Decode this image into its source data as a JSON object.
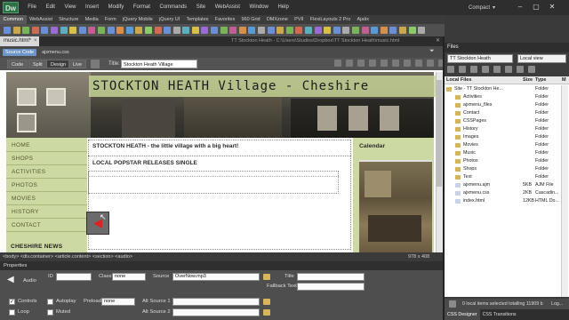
{
  "app": {
    "logo": "Dw",
    "menu": [
      "File",
      "Edit",
      "View",
      "Insert",
      "Modify",
      "Format",
      "Commands",
      "Site",
      "WebAssist",
      "Window",
      "Help"
    ],
    "workspace": "Compact",
    "window_controls": [
      "–",
      "▢",
      "✕"
    ]
  },
  "insert_bar": {
    "tabs": [
      "Common",
      "WebAssist",
      "Structure",
      "Media",
      "Form",
      "jQuery Mobile",
      "jQuery UI",
      "Templates",
      "Favorites",
      "960 Grid",
      "DMXzone",
      "PVII",
      "FlexiLayouts 2 Pro",
      "Ajatix"
    ],
    "active_tab": "Common",
    "icon_colors": [
      "#6b8fd6",
      "#c9a94a",
      "#7bb35a",
      "#d06a50",
      "#6b8fd6",
      "#9a6ad6",
      "#5ab0c0",
      "#d6c04a",
      "#6b8fd6",
      "#c06090",
      "#7bb35a",
      "#6b8fd6",
      "#d6904a",
      "#5a9ad6",
      "#c9a94a",
      "#8acb6a",
      "#d06a50",
      "#6b8fd6",
      "#aaaaaa",
      "#5ab0c0",
      "#d6c04a",
      "#9a6ad6",
      "#6b8fd6",
      "#7bb35a",
      "#c06090",
      "#d6904a",
      "#5a9ad6",
      "#aaaaaa",
      "#6b8fd6",
      "#c9a94a",
      "#7bb35a",
      "#d06a50",
      "#5ab0c0",
      "#9a6ad6",
      "#d6c04a",
      "#6b8fd6",
      "#aaaaaa",
      "#7bb35a",
      "#c06090",
      "#5a9ad6",
      "#d6904a",
      "#6b8fd6",
      "#c9a94a",
      "#8acb6a",
      "#aaaaaa"
    ]
  },
  "document": {
    "tab_label": "music.html*",
    "tab_close": "×",
    "path": "TT Stockton Heath - C:\\Users\\Studios\\Dropbox\\TT Stockton Heath\\music.html",
    "path_close": "✕",
    "related_files": [
      "Source Code",
      "ajxmenu.css"
    ],
    "view_buttons": [
      "Code",
      "Split",
      "Design",
      "Live"
    ],
    "title_label": "Title:",
    "title_value": "Stockton Heath Village"
  },
  "page": {
    "banner_title": "STOCKTON HEATH Village - Cheshire",
    "nav": [
      "HOME",
      "SHOPS",
      "ACTIVITIES",
      "PHOTOS",
      "MOVIES",
      "HISTORY",
      "CONTACT"
    ],
    "news_heading": "CHESHIRE NEWS",
    "headline": "STOCKTON HEATH - the little village with a big heart!",
    "section_heading": "LOCAL POPSTAR RELEASES SINGLE",
    "calendar_heading": "Calendar"
  },
  "status": {
    "tag_path": "<body> <div.container> <article.content> <section> <audio>",
    "window_size": "978 x 408"
  },
  "properties": {
    "title": "Properties",
    "element_label": "Audio",
    "id_label": "ID",
    "class_label": "Class",
    "class_value": "none",
    "source_label": "Source",
    "source_value": "OverNow.mp3",
    "title_label": "Title",
    "fallback_label": "Fallback Text",
    "controls_label": "Controls",
    "autoplay_label": "Autoplay",
    "preload_label": "Preload",
    "preload_value": "none",
    "alt1_label": "Alt Source 1",
    "alt2_label": "Alt Source 2",
    "loop_label": "Loop",
    "muted_label": "Muted",
    "controls_checked": true,
    "autoplay_checked": false,
    "loop_checked": false,
    "muted_checked": false
  },
  "files_panel": {
    "tab": "Files",
    "site": "TT Stockton Heath",
    "view": "Local view",
    "columns": [
      "Local Files",
      "Size",
      "Type",
      "M"
    ],
    "rows": [
      {
        "name": "Site - TT Stockton He...",
        "size": "",
        "type": "Folder",
        "m": "1",
        "kind": "site"
      },
      {
        "name": "Activities",
        "size": "",
        "type": "Folder",
        "m": "1",
        "kind": "folder"
      },
      {
        "name": "ajxmenu_files",
        "size": "",
        "type": "Folder",
        "m": "1",
        "kind": "folder"
      },
      {
        "name": "Contact",
        "size": "",
        "type": "Folder",
        "m": "1",
        "kind": "folder"
      },
      {
        "name": "CSSPages",
        "size": "",
        "type": "Folder",
        "m": "1",
        "kind": "folder"
      },
      {
        "name": "History",
        "size": "",
        "type": "Folder",
        "m": "1",
        "kind": "folder"
      },
      {
        "name": "Images",
        "size": "",
        "type": "Folder",
        "m": "1",
        "kind": "folder"
      },
      {
        "name": "Movies",
        "size": "",
        "type": "Folder",
        "m": "1",
        "kind": "folder"
      },
      {
        "name": "Music",
        "size": "",
        "type": "Folder",
        "m": "1",
        "kind": "folder"
      },
      {
        "name": "Photos",
        "size": "",
        "type": "Folder",
        "m": "1",
        "kind": "folder"
      },
      {
        "name": "Shops",
        "size": "",
        "type": "Folder",
        "m": "1",
        "kind": "folder"
      },
      {
        "name": "Text",
        "size": "",
        "type": "Folder",
        "m": "1",
        "kind": "folder"
      },
      {
        "name": "ajxmenu.ajm",
        "size": "5KB",
        "type": "AJM File",
        "m": "0",
        "kind": "file"
      },
      {
        "name": "ajxmenu.css",
        "size": "2KB",
        "type": "Cascadin...",
        "m": "0",
        "kind": "file"
      },
      {
        "name": "index.html",
        "size": "12KB",
        "type": "HTML Do...",
        "m": "0",
        "kind": "file"
      }
    ],
    "status": "0 local items selected totalling 11909 b",
    "log_label": "Log...",
    "bottom_tabs": [
      "CSS Designer",
      "CSS Transitions"
    ]
  },
  "colors": {
    "accent": "#6d95c7",
    "nav_bg": "#cdd9a2",
    "nav_text": "#55582e",
    "folder": "#d8b55a",
    "logo": "#2f6f47"
  }
}
